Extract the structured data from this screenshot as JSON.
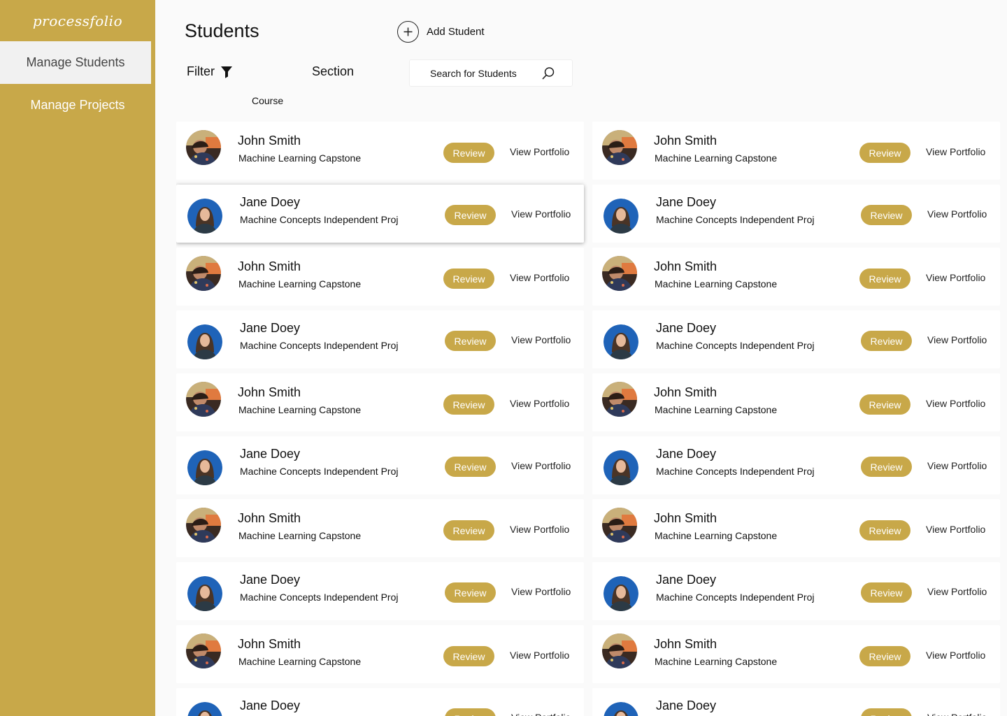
{
  "app": {
    "logo": "processfolio"
  },
  "sidebar": {
    "items": [
      {
        "label": "Manage Students",
        "active": true
      },
      {
        "label": "Manage Projects",
        "active": false
      }
    ]
  },
  "header": {
    "title": "Students",
    "add_student": "Add Student",
    "filter_label": "Filter",
    "course_label": "Course",
    "section_label": "Section",
    "search_placeholder": "Search for Students"
  },
  "students": [
    {
      "name": "John Smith",
      "course": "Machine Learning Capstone",
      "avatar": "john"
    },
    {
      "name": "John Smith",
      "course": "Machine Learning Capstone",
      "avatar": "john"
    },
    {
      "name": "Jane Doey",
      "course": "Machine Concepts Independent Proj",
      "avatar": "jane",
      "raised": true
    },
    {
      "name": "Jane Doey",
      "course": "Machine Concepts Independent Proj",
      "avatar": "jane"
    },
    {
      "name": "John Smith",
      "course": "Machine Learning Capstone",
      "avatar": "john"
    },
    {
      "name": "John Smith",
      "course": "Machine Learning Capstone",
      "avatar": "john"
    },
    {
      "name": "Jane Doey",
      "course": "Machine Concepts Independent Proj",
      "avatar": "jane"
    },
    {
      "name": "Jane Doey",
      "course": "Machine Concepts Independent Proj",
      "avatar": "jane"
    },
    {
      "name": "John Smith",
      "course": "Machine Learning Capstone",
      "avatar": "john"
    },
    {
      "name": "John Smith",
      "course": "Machine Learning Capstone",
      "avatar": "john"
    },
    {
      "name": "Jane Doey",
      "course": "Machine Concepts Independent Proj",
      "avatar": "jane"
    },
    {
      "name": "Jane Doey",
      "course": "Machine Concepts Independent Proj",
      "avatar": "jane"
    },
    {
      "name": "John Smith",
      "course": "Machine Learning Capstone",
      "avatar": "john"
    },
    {
      "name": "John Smith",
      "course": "Machine Learning Capstone",
      "avatar": "john"
    },
    {
      "name": "Jane Doey",
      "course": "Machine Concepts Independent Proj",
      "avatar": "jane"
    },
    {
      "name": "Jane Doey",
      "course": "Machine Concepts Independent Proj",
      "avatar": "jane"
    },
    {
      "name": "John Smith",
      "course": "Machine Learning Capstone",
      "avatar": "john"
    },
    {
      "name": "John Smith",
      "course": "Machine Learning Capstone",
      "avatar": "john"
    },
    {
      "name": "Jane Doey",
      "course": "",
      "avatar": "jane"
    },
    {
      "name": "Jane Doey",
      "course": "",
      "avatar": "jane"
    }
  ],
  "card_actions": {
    "review": "Review",
    "view_portfolio": "View Portfolio"
  },
  "colors": {
    "accent": "#c8a849",
    "sidebar_active_bg": "#f1f1f1",
    "page_bg": "#fafafa"
  }
}
